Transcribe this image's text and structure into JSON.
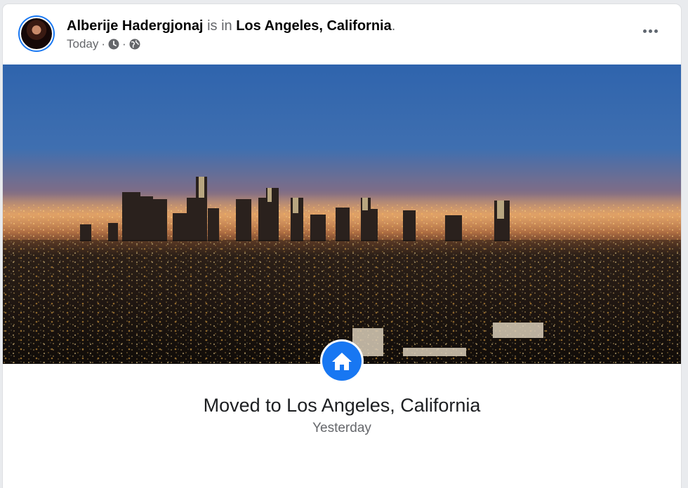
{
  "post": {
    "author": "Alberije Hadergjonaj",
    "connector": "is in",
    "location": "Los Angeles, California",
    "period": ".",
    "time": "Today",
    "separator": "·",
    "privacy_icon": "globe-icon",
    "clock_icon": "clock-icon",
    "more_icon": "more-horizontal-icon"
  },
  "life_event": {
    "icon": "home-icon",
    "title": "Moved to Los Angeles, California",
    "date": "Yesterday"
  },
  "colors": {
    "accent": "#1877f2",
    "text_primary": "#050505",
    "text_secondary": "#65676b"
  }
}
